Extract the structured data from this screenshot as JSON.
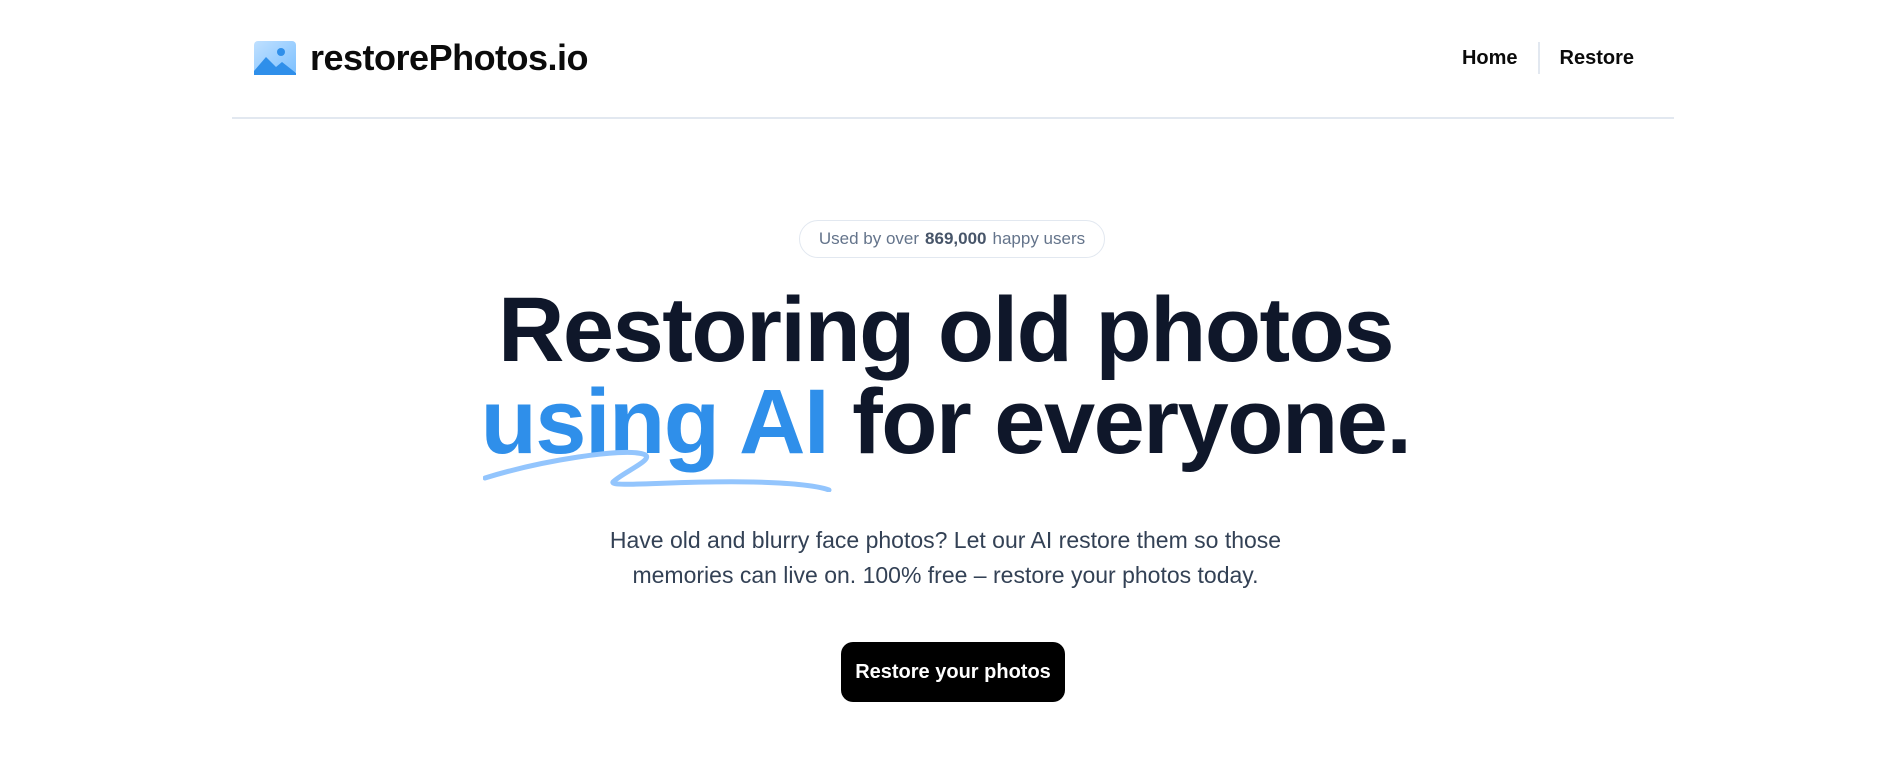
{
  "header": {
    "brand_name": "restorePhotos.io",
    "brand_icon": "photo-icon",
    "nav": {
      "home_label": "Home",
      "restore_label": "Restore"
    }
  },
  "hero": {
    "badge": {
      "prefix": "Used by over",
      "count": "869,000",
      "suffix": "happy users"
    },
    "headline": {
      "line1": "Restoring old photos",
      "accent": "using AI",
      "line2_rest": "for everyone."
    },
    "subtext_line1": "Have old and blurry face photos? Let our AI restore them so those",
    "subtext_line2": "memories can live on. 100% free – restore your photos today.",
    "cta_label": "Restore your photos"
  },
  "colors": {
    "accent": "#2f8fea",
    "underline": "#93c5fd",
    "text_dark": "#0f172a",
    "cta_background": "#000000"
  }
}
